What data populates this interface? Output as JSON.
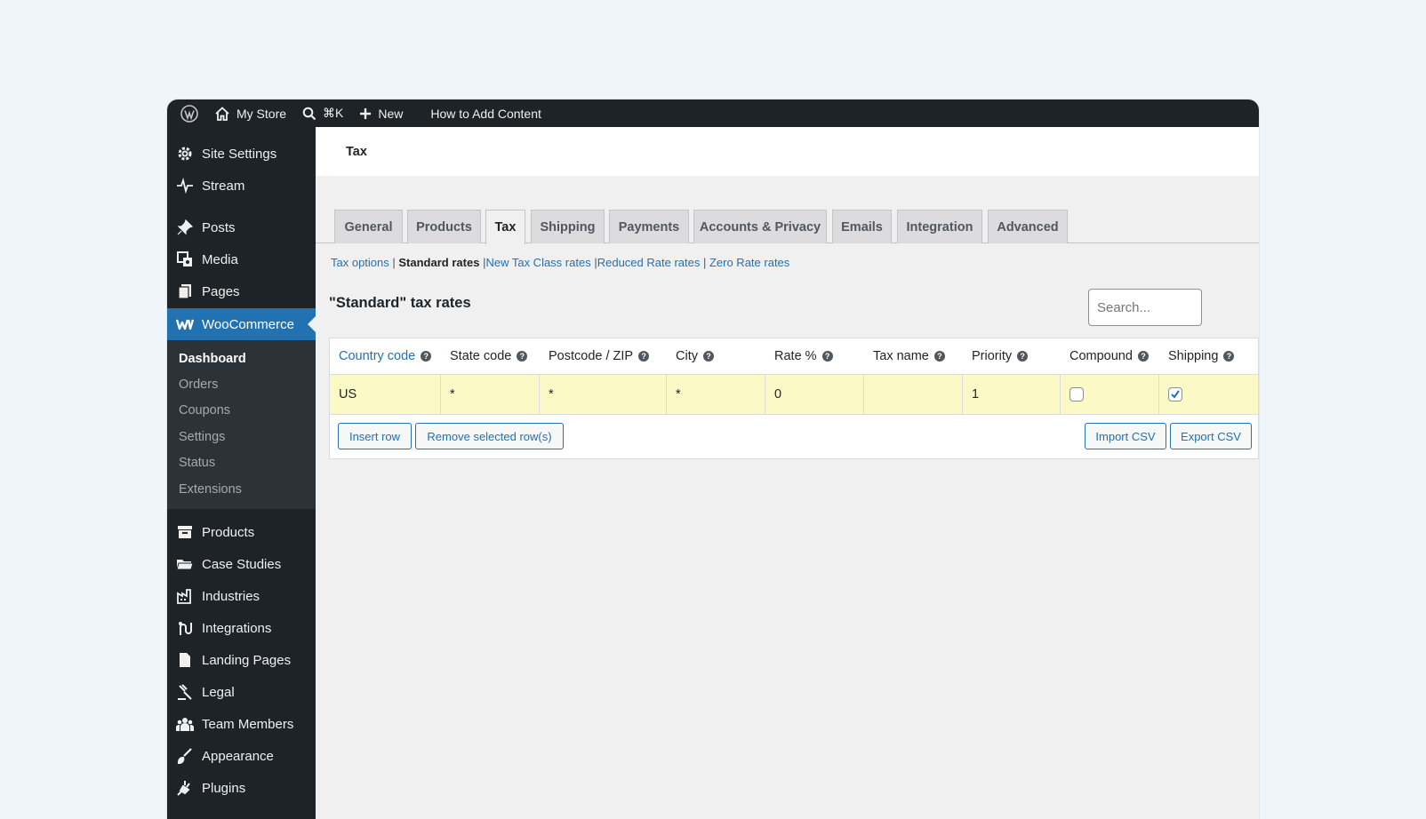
{
  "adminbar": {
    "site_name": "My Store",
    "search_shortcut": "⌘K",
    "new_label": "New",
    "help_label": "How to Add Content"
  },
  "sidebar": {
    "top_items": [
      {
        "label": "Site Settings",
        "icon": "gear-icon"
      },
      {
        "label": "Stream",
        "icon": "pulse-icon"
      },
      {
        "label": "Posts",
        "icon": "pin-icon"
      },
      {
        "label": "Media",
        "icon": "media-icon"
      },
      {
        "label": "Pages",
        "icon": "pages-icon"
      },
      {
        "label": "WooCommerce",
        "icon": "woocommerce-icon"
      }
    ],
    "submenu": [
      "Dashboard",
      "Orders",
      "Coupons",
      "Settings",
      "Status",
      "Extensions"
    ],
    "bottom_items": [
      {
        "label": "Products",
        "icon": "archive-icon"
      },
      {
        "label": "Case Studies",
        "icon": "folder-icon"
      },
      {
        "label": "Industries",
        "icon": "factory-icon"
      },
      {
        "label": "Integrations",
        "icon": "integration-icon"
      },
      {
        "label": "Landing Pages",
        "icon": "document-icon"
      },
      {
        "label": "Legal",
        "icon": "gavel-icon"
      },
      {
        "label": "Team Members",
        "icon": "team-icon"
      },
      {
        "label": "Appearance",
        "icon": "brush-icon"
      },
      {
        "label": "Plugins",
        "icon": "plugin-icon"
      }
    ]
  },
  "page": {
    "title": "Tax",
    "tabs": [
      "General",
      "Products",
      "Tax",
      "Shipping",
      "Payments",
      "Accounts & Privacy",
      "Emails",
      "Integration",
      "Advanced"
    ],
    "active_tab": "Tax",
    "subsub": {
      "tax_options": "Tax options",
      "standard": "Standard rates",
      "new_class": "New Tax Class rates",
      "reduced": "Reduced Rate rates",
      "zero": "Zero Rate rates"
    },
    "rates_title": "\"Standard\" tax rates",
    "search_placeholder": "Search..."
  },
  "table": {
    "columns": [
      "Country code",
      "State code",
      "Postcode / ZIP",
      "City",
      "Rate %",
      "Tax name",
      "Priority",
      "Compound",
      "Shipping"
    ],
    "rows": [
      {
        "country": "US",
        "state": "*",
        "postcode": "*",
        "city": "*",
        "rate": "0",
        "tax_name": "",
        "priority": "1",
        "compound": false,
        "shipping": true
      }
    ],
    "buttons": {
      "insert": "Insert row",
      "remove": "Remove selected row(s)",
      "import": "Import CSV",
      "export": "Export CSV"
    }
  }
}
